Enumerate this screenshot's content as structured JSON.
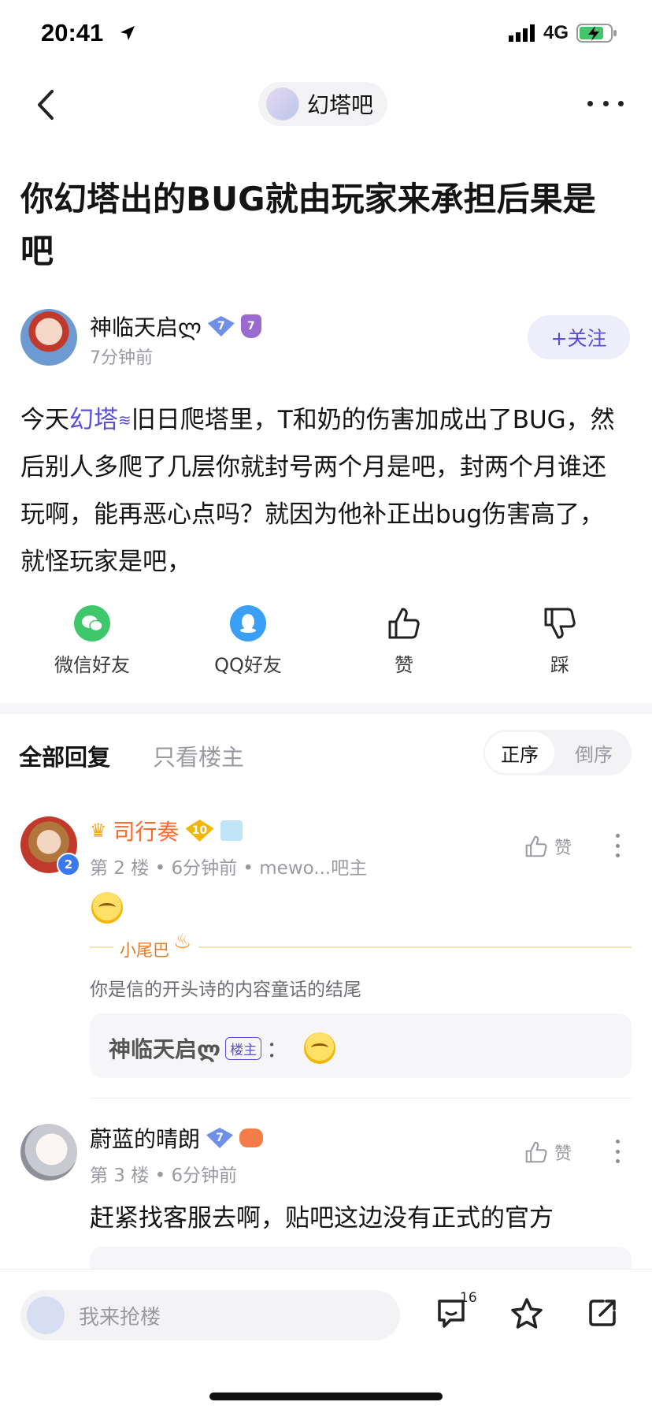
{
  "status_bar": {
    "time": "20:41",
    "carrier": "4G"
  },
  "nav": {
    "forum_name": "幻塔吧"
  },
  "post": {
    "title": "你幻塔出的BUG就由玩家来承担后果是吧",
    "author": {
      "name": "神临天启ლ",
      "level": "7",
      "time": "7分钟前"
    },
    "follow_label": "+关注",
    "body_prefix": "今天",
    "body_forum_link": "幻塔",
    "body_rest": "旧日爬塔里，T和奶的伤害加成出了BUG，然后别人多爬了几层你就封号两个月是吧，封两个月谁还玩啊，能再恶心点吗？就因为他补正出bug伤害高了，就怪玩家是吧，"
  },
  "share": [
    {
      "label": "微信好友"
    },
    {
      "label": "QQ好友"
    },
    {
      "label": "赞"
    },
    {
      "label": "踩"
    }
  ],
  "tabs": {
    "all": "全部回复",
    "op_only": "只看楼主",
    "sort_asc": "正序",
    "sort_desc": "倒序"
  },
  "replies": [
    {
      "name": "司行奏",
      "level": "10",
      "avatar_badge": "2",
      "meta": "第 2 楼 • 6分钟前 • mewo...吧主",
      "like_label": "赞",
      "tail_label": "小尾巴",
      "signature": "你是信的开头诗的内容童话的结尾",
      "sub_reply": {
        "name": "神临天启ლ",
        "op_tag": "楼主",
        "sep": "："
      }
    },
    {
      "name": "蔚蓝的晴朗",
      "level": "7",
      "meta": "第 3 楼 • 6分钟前",
      "like_label": "赞",
      "content": "赶紧找客服去啊，贴吧这边没有正式的官方"
    }
  ],
  "bottom_bar": {
    "input_placeholder": "我来抢楼",
    "comment_count": "16"
  },
  "colors": {
    "accent": "#5a4fd6",
    "wechat": "#3fc86b",
    "qq": "#3aa0f5",
    "vip_name": "#ff6a2b"
  }
}
